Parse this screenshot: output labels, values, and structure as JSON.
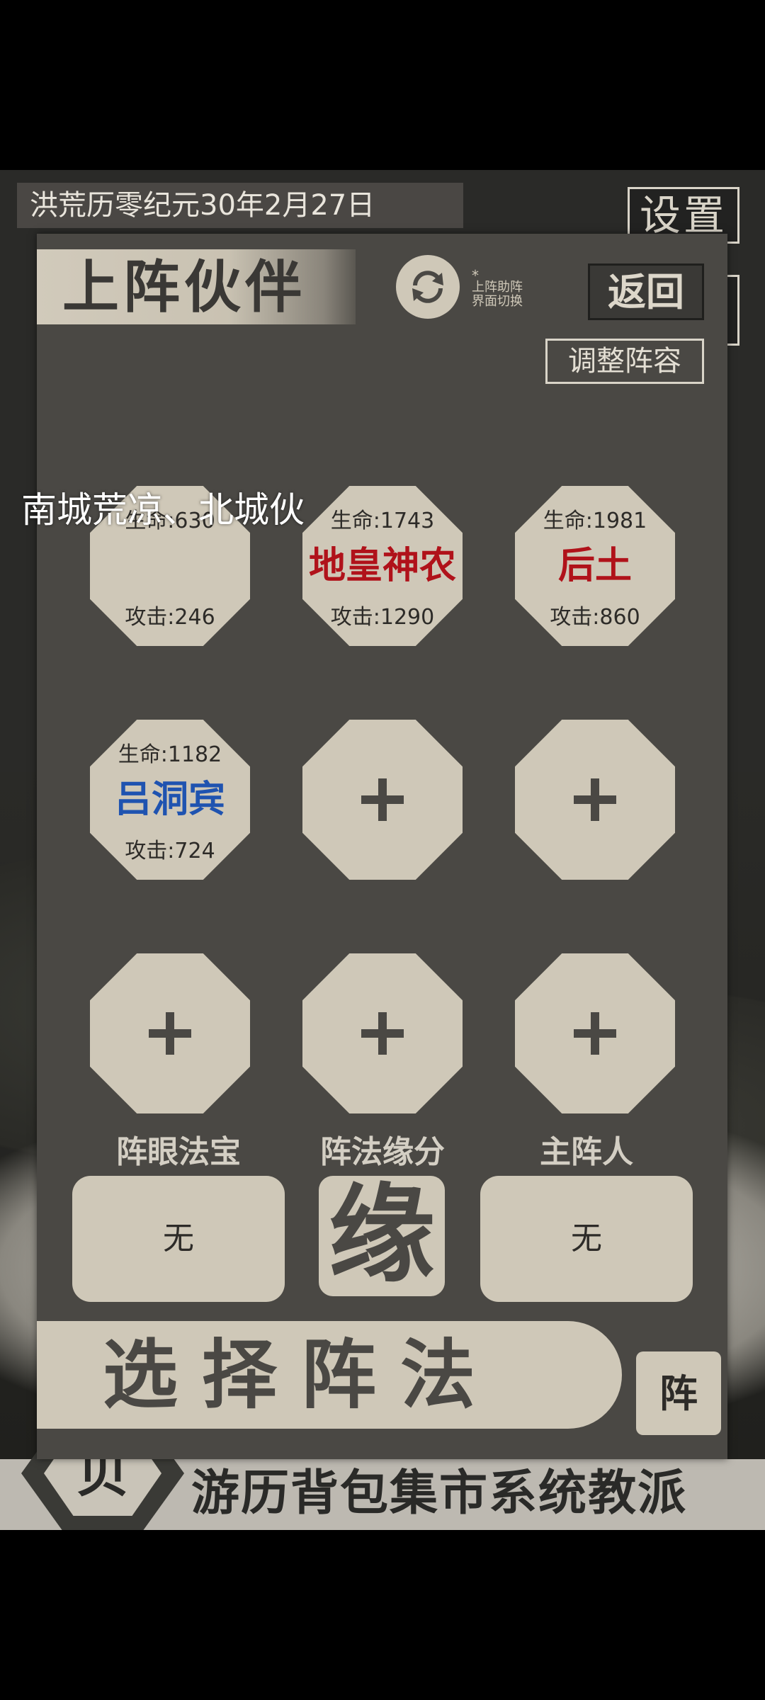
{
  "background": {
    "date": "洪荒历零纪元30年2月27日",
    "settings_label": "设置",
    "ticker": "南城荒凉、北城伙",
    "nav_items": [
      "游历",
      "背包",
      "集市",
      "系统",
      "教派"
    ],
    "emblem_char": "贝"
  },
  "panel": {
    "title": "上阵伙伴",
    "switch_note_star": "*",
    "switch_note_line1": "上阵助阵",
    "switch_note_line2": "界面切换",
    "back_label": "返回",
    "adjust_label": "调整阵容",
    "slots": [
      {
        "hp": "生命:630",
        "name": "",
        "atk": "攻击:246"
      },
      {
        "hp": "生命:1743",
        "name": "地皇神农",
        "atk": "攻击:1290",
        "color": "#b0121a"
      },
      {
        "hp": "生命:1981",
        "name": "后土",
        "atk": "攻击:860",
        "color": "#b0121a"
      },
      {
        "hp": "生命:1182",
        "name": "吕洞宾",
        "atk": "攻击:724",
        "color": "#1f53b0"
      }
    ],
    "eye_treasure_label": "阵眼法宝",
    "eye_treasure_value": "无",
    "fate_label": "阵法缘分",
    "fate_char": "缘",
    "main_leader_label": "主阵人",
    "main_leader_value": "无",
    "select_formation_label": "选择阵法",
    "formation_char": "阵"
  }
}
